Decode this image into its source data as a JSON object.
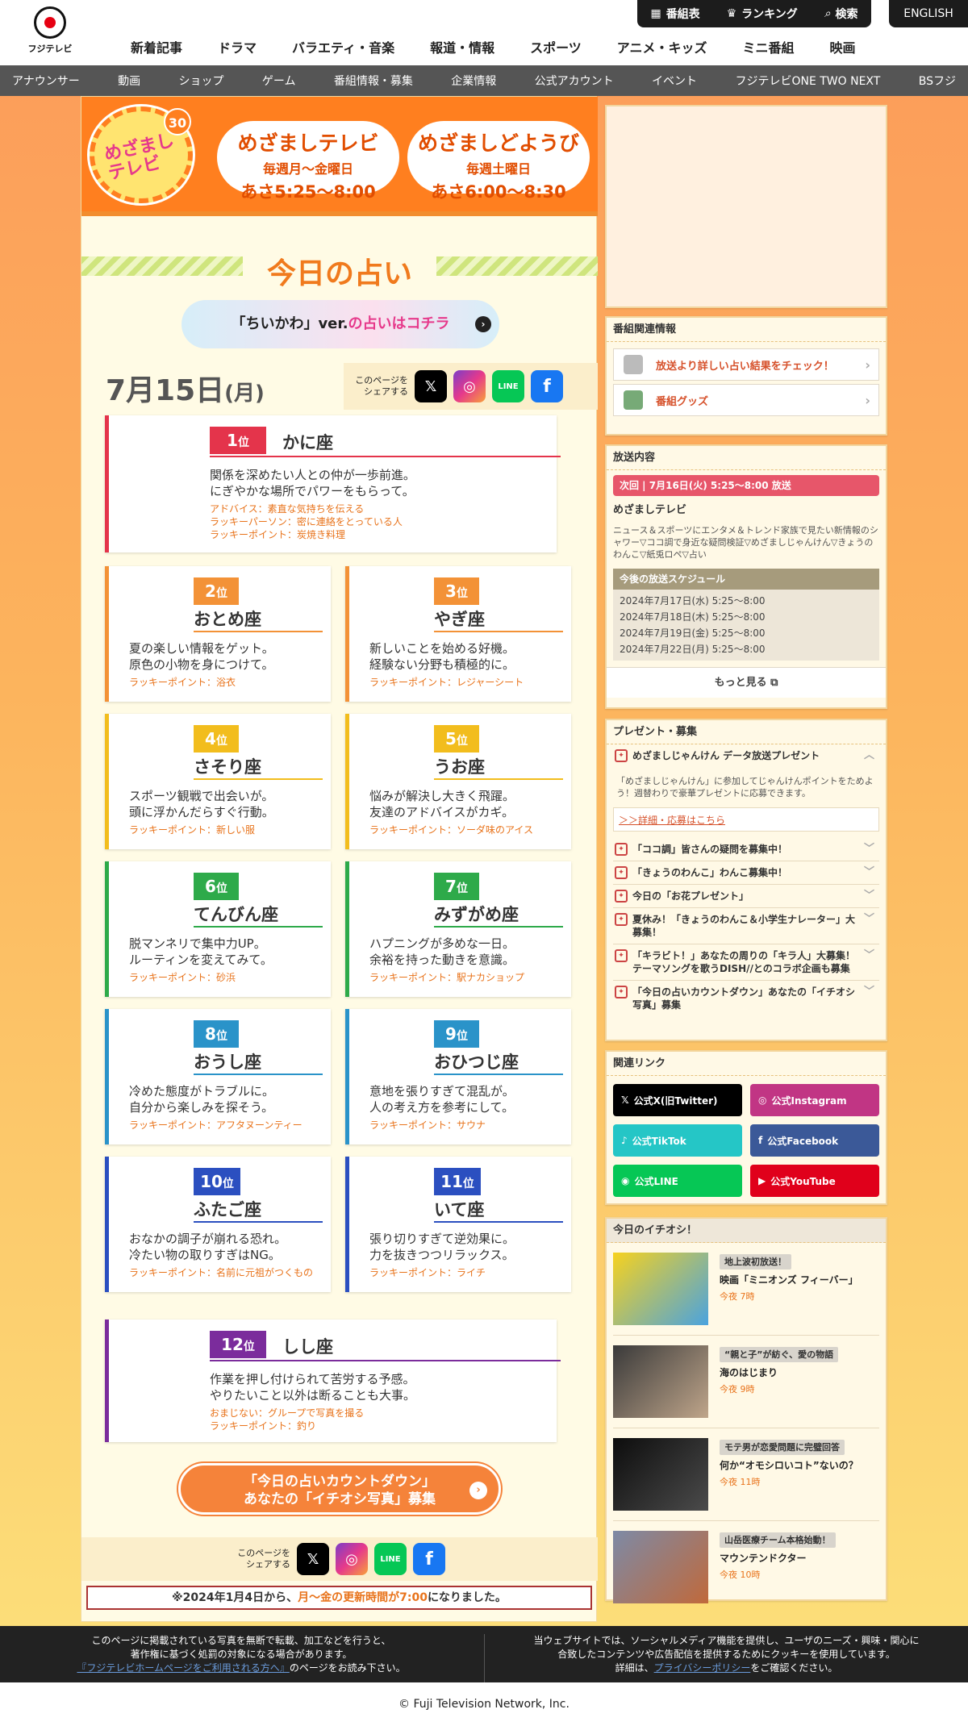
{
  "header": {
    "logo_text": "フジテレビ",
    "util": [
      "番組表",
      "ランキング",
      "検索"
    ],
    "english": "ENGLISH",
    "main_nav": [
      "新着記事",
      "ドラマ",
      "バラエティ・音楽",
      "報道・情報",
      "スポーツ",
      "アニメ・キッズ",
      "ミニ番組",
      "映画"
    ],
    "sub_nav": [
      "アナウンサー",
      "動画",
      "ショップ",
      "ゲーム",
      "番組情報・募集",
      "企業情報",
      "公式アカウント",
      "イベント",
      "フジテレビONE TWO NEXT",
      "BSフジ"
    ]
  },
  "banner": {
    "logo_text": "めざましテレビ",
    "badge": "30",
    "show1": {
      "name": "めざましテレビ",
      "days": "毎週月〜金曜日",
      "time": "あさ5:25〜8:00"
    },
    "show2": {
      "name": "めざましどようび",
      "days": "毎週土曜日",
      "time": "あさ6:00〜8:30"
    }
  },
  "fortune": {
    "title": "今日の占い",
    "chiikawa_pre": "「ちいかわ」ver.",
    "chiikawa_hl": "の占いはコチラ",
    "date_main": "7月15日",
    "date_day": "(月)",
    "share_label": "このページを シェアする",
    "share_icons": [
      "X",
      "Instagram",
      "LINE",
      "Facebook"
    ],
    "ranks": [
      {
        "rank": "1",
        "unit": "位",
        "sign": "かに座",
        "lines": [
          "関係を深めたい人との仲が一歩前進。",
          "にぎやかな場所でパワーをもらって。"
        ],
        "luck": [
          "アドバイス：素直な気持ちを伝える",
          "ラッキーパーソン：密に連絡をとっている人",
          "ラッキーポイント：炭焼き料理"
        ]
      },
      {
        "rank": "2",
        "unit": "位",
        "sign": "おとめ座",
        "lines": [
          "夏の楽しい情報をゲット。",
          "原色の小物を身につけて。"
        ],
        "luck": [
          "ラッキーポイント：浴衣"
        ]
      },
      {
        "rank": "3",
        "unit": "位",
        "sign": "やぎ座",
        "lines": [
          "新しいことを始める好機。",
          "経験ない分野も積極的に。"
        ],
        "luck": [
          "ラッキーポイント：レジャーシート"
        ]
      },
      {
        "rank": "4",
        "unit": "位",
        "sign": "さそり座",
        "lines": [
          "スポーツ観戦で出会いが。",
          "頭に浮かんだらすぐ行動。"
        ],
        "luck": [
          "ラッキーポイント：新しい服"
        ]
      },
      {
        "rank": "5",
        "unit": "位",
        "sign": "うお座",
        "lines": [
          "悩みが解決し大きく飛躍。",
          "友達のアドバイスがカギ。"
        ],
        "luck": [
          "ラッキーポイント：ソーダ味のアイス"
        ]
      },
      {
        "rank": "6",
        "unit": "位",
        "sign": "てんびん座",
        "lines": [
          "脱マンネリで集中力UP。",
          "ルーティンを変えてみて。"
        ],
        "luck": [
          "ラッキーポイント：砂浜"
        ]
      },
      {
        "rank": "7",
        "unit": "位",
        "sign": "みずがめ座",
        "lines": [
          "ハプニングが多めな一日。",
          "余裕を持った動きを意識。"
        ],
        "luck": [
          "ラッキーポイント：駅ナカショップ"
        ]
      },
      {
        "rank": "8",
        "unit": "位",
        "sign": "おうし座",
        "lines": [
          "冷めた態度がトラブルに。",
          "自分から楽しみを探そう。"
        ],
        "luck": [
          "ラッキーポイント：アフタヌーンティー"
        ]
      },
      {
        "rank": "9",
        "unit": "位",
        "sign": "おひつじ座",
        "lines": [
          "意地を張りすぎて混乱が。",
          "人の考え方を参考にして。"
        ],
        "luck": [
          "ラッキーポイント：サウナ"
        ]
      },
      {
        "rank": "10",
        "unit": "位",
        "sign": "ふたご座",
        "lines": [
          "おなかの調子が崩れる恐れ。",
          "冷たい物の取りすぎはNG。"
        ],
        "luck": [
          "ラッキーポイント：名前に元祖がつくもの"
        ]
      },
      {
        "rank": "11",
        "unit": "位",
        "sign": "いて座",
        "lines": [
          "張り切りすぎて逆効果に。",
          "力を抜きつつリラックス。"
        ],
        "luck": [
          "ラッキーポイント：ライチ"
        ]
      },
      {
        "rank": "12",
        "unit": "位",
        "sign": "しし座",
        "lines": [
          "作業を押し付けられて苦労する予感。",
          "やりたいこと以外は断ることも大事。"
        ],
        "luck": [
          "おまじない：グループで写真を撮る",
          "ラッキーポイント：釣り"
        ]
      }
    ],
    "cta_line1": "「今日の占いカウントダウン」",
    "cta_line2": "あなたの「イチオシ写真」募集",
    "notice_pre": "※2024年1月4日から、",
    "notice_hl1": "月〜金の更新時間が7:00",
    "notice_post": "になりました。"
  },
  "sidebar": {
    "related_title": "番組関連情報",
    "related_items": [
      "放送より詳しい占い結果をチェック！",
      "番組グッズ"
    ],
    "broadcast_title": "放送内容",
    "next_label": "次回 | 7月16日(火) 5:25〜8:00 放送",
    "program": "めざましテレビ",
    "program_desc": "ニュース＆スポーツにエンタメ＆トレンド家族で見たい新情報のシャワー▽ココ調で身近な疑問検証▽めざましじゃんけん▽きょうのわんこ▽紙兎ロペ▽占い",
    "schedule_title": "今後の放送スケジュール",
    "schedule": [
      "2024年7月17日(水) 5:25〜8:00",
      "2024年7月18日(木) 5:25〜8:00",
      "2024年7月19日(金) 5:25〜8:00",
      "2024年7月22日(月) 5:25〜8:00"
    ],
    "more": "もっと見る",
    "present_title": "プレゼント・募集",
    "present_open": "めざましじゃんけん データ放送プレゼント",
    "present_open_desc": "「めざましじゃんけん」に参加してじゃんけんポイントをためよう！週替わりで豪華プレゼントに応募できます。",
    "present_link": "＞＞詳細・応募はこちら",
    "present_items": [
      "「ココ調」皆さんの疑問を募集中！",
      "「きょうのわんこ」わんこ募集中！",
      "今日の「お花プレゼント」",
      "夏休み！「きょうのわんこ＆小学生ナレーター」大募集！",
      "「キラビト！」あなたの周りの「キラ人」大募集！テーマソングを歌うDISH//とのコラボ企画も募集",
      "「今日の占いカウントダウン」あなたの「イチオシ写真」募集"
    ],
    "links_title": "関連リンク",
    "links": [
      "公式X(旧Twitter)",
      "公式Instagram",
      "公式TikTok",
      "公式Facebook",
      "公式LINE",
      "公式YouTube"
    ],
    "picks_title": "今日のイチオシ！",
    "picks": [
      {
        "tag": "地上波初放送！",
        "title": "映画「ミニオンズ フィーバー」",
        "time": "今夜 7時"
      },
      {
        "tag": "“親と子”が紡ぐ、愛の物語",
        "title": "海のはじまり",
        "time": "今夜 9時"
      },
      {
        "tag": "モテ男が恋愛問題に完璧回答",
        "title": "何か“オモシロいコト”ないの？",
        "time": "今夜 11時"
      },
      {
        "tag": "山岳医療チーム本格始動！",
        "title": "マウンテンドクター",
        "time": "今夜 10時"
      }
    ]
  },
  "footer": {
    "left1": "このページに掲載されている写真を無断で転載、加工などを行うと、",
    "left2": "著作権に基づく処罰の対象になる場合があります。",
    "left_link": "『フジテレビホームページをご利用される方へ』",
    "left3": "のページをお読み下さい。",
    "right1": "当ウェブサイトでは、ソーシャルメディア機能を提供し、ユーザのニーズ・興味・関心に",
    "right2": "合致したコンテンツや広告配信を提供するためにクッキーを使用しています。",
    "right3_pre": "詳細は、",
    "right_link": "プライバシーポリシー",
    "right3_post": "をご確認ください。",
    "copyright": "© Fuji Television Network, Inc."
  },
  "colors": {
    "rank1": "#e4344b",
    "rank2": "#f39237",
    "rank3": "#f39237",
    "rank4": "#f2bd1d",
    "rank5": "#f2bd1d",
    "rank6": "#2eaa4a",
    "rank7": "#2eaa4a",
    "rank8": "#2a93c9",
    "rank9": "#2a93c9",
    "rank10": "#2b4fc0",
    "rank11": "#2b4fc0",
    "rank12": "#7b2c9c"
  }
}
